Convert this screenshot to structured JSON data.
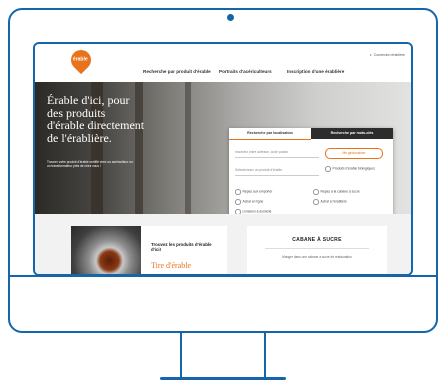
{
  "site": {
    "logo_text": "érable",
    "util_link": "Connexion érablière",
    "nav": [
      "Recherche par produit d'érable",
      "Portraits d'acériculteurs",
      "Inscription d'une érablière"
    ]
  },
  "hero": {
    "title": "Érable d'ici, pour des produits d'érable directement de l'érablière.",
    "subtitle": "Trouver votre produit d'érable certifié chez un acériculteur ou un transformateur près de chez vous !"
  },
  "search": {
    "tab_location": "Recherche par localisation",
    "tab_name": "Recherche par mots-clés",
    "address_placeholder": "Inscrivez votre adresse, code postal",
    "near_me": "Me géolocaliser",
    "product_placeholder": "Sélectionnez un produit d'érable",
    "organic": "Produits d'érable biologiques",
    "checks": [
      "Repas aux emporter",
      "Repas à la cabane à sucre",
      "Achat en ligne",
      "Achat à l'érablière",
      "Livraison à domicile"
    ],
    "button": "Recherche"
  },
  "cards": {
    "find_title": "Trouvez les produits d'érable d'ici!",
    "find_sub": "Tire d'érable",
    "cabane_title": "CABANE À SUCRE",
    "cabane_text": "Manger dans une cabane à sucre de restauration"
  }
}
